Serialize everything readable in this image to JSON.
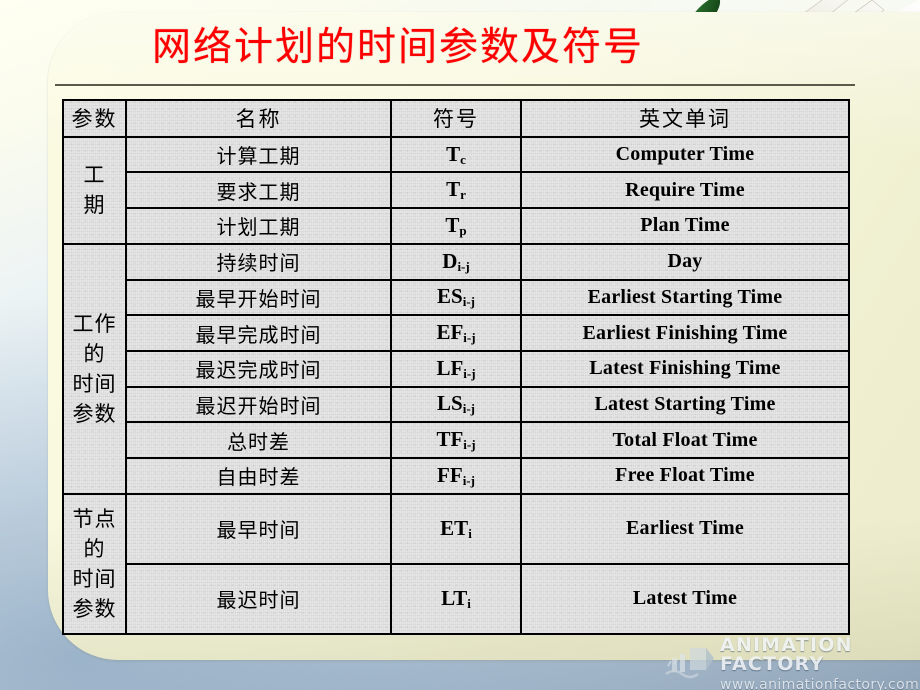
{
  "slide": {
    "title": "网络计划的时间参数及符号",
    "title_color": "#ff0000",
    "panel_color": "#f7f7dc",
    "background_top_color": "#fffff2",
    "background_bottom_color": "#8fa3b8"
  },
  "decoration": {
    "dove_icon": "dove-with-olive-branch",
    "leaf_color": "#1d5c22",
    "wing_color": "#f6f4ee"
  },
  "table": {
    "headers": [
      "参数",
      "名称",
      "符号",
      "英文单词"
    ],
    "groups": [
      {
        "label": "工期",
        "label_lines": [
          "工",
          "期"
        ],
        "rows": [
          {
            "name": "计算工期",
            "symbol_base": "T",
            "symbol_sub": "c",
            "english": "Computer Time"
          },
          {
            "name": "要求工期",
            "symbol_base": "T",
            "symbol_sub": "r",
            "english": "Require Time"
          },
          {
            "name": "计划工期",
            "symbol_base": "T",
            "symbol_sub": "p",
            "english": "Plan Time"
          }
        ]
      },
      {
        "label": "工作的时间参数",
        "label_lines": [
          "工作",
          "的",
          "时间",
          "参数"
        ],
        "rows": [
          {
            "name": "持续时间",
            "symbol_base": "D",
            "symbol_sub": "i-j",
            "english": "Day"
          },
          {
            "name": "最早开始时间",
            "symbol_base": "ES",
            "symbol_sub": "i-j",
            "english": "Earliest Starting Time"
          },
          {
            "name": "最早完成时间",
            "symbol_base": "EF",
            "symbol_sub": "i-j",
            "english": "Earliest Finishing Time"
          },
          {
            "name": "最迟完成时间",
            "symbol_base": "LF",
            "symbol_sub": "i-j",
            "english": "Latest Finishing Time"
          },
          {
            "name": "最迟开始时间",
            "symbol_base": "LS",
            "symbol_sub": "i-j",
            "english": "Latest Starting Time"
          },
          {
            "name": "总时差",
            "symbol_base": "TF",
            "symbol_sub": "i-j",
            "english": "Total Float Time"
          },
          {
            "name": "自由时差",
            "symbol_base": "FF",
            "symbol_sub": "i-j",
            "english": "Free Float Time"
          }
        ]
      },
      {
        "label": "节点的时间参数",
        "label_lines": [
          "节点",
          "的",
          "时间",
          "参数"
        ],
        "rows": [
          {
            "name": "最早时间",
            "symbol_base": "ET",
            "symbol_sub": "i",
            "english": "Earliest Time"
          },
          {
            "name": "最迟时间",
            "symbol_base": "LT",
            "symbol_sub": "i",
            "english": "Latest Time"
          }
        ]
      }
    ]
  },
  "watermark": {
    "brand": "ANIMATION FACTORY",
    "url": "www.animationfactory.com"
  }
}
